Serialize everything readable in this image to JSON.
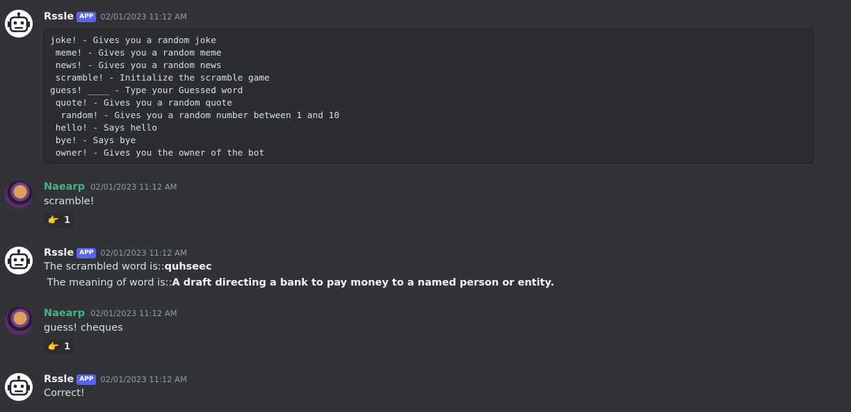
{
  "messages": [
    {
      "author": "Rssle",
      "badge": "APP",
      "timestamp": "02/01/2023 11:12 AM",
      "code_lines": [
        "joke! - Gives you a random joke",
        " meme! - Gives you a random meme",
        " news! - Gives you a random news",
        " scramble! - Initialize the scramble game",
        "guess! ____ - Type your Guessed word",
        " quote! - Gives you a random quote",
        "  random! - Gives you a random number between 1 and 10",
        " hello! - Says hello",
        " bye! - Says bye",
        " owner! - Gives you the owner of the bot"
      ]
    },
    {
      "author": "Naearp",
      "timestamp": "02/01/2023 11:12 AM",
      "text": "scramble!",
      "reaction": {
        "emoji": "👉",
        "count": "1"
      }
    },
    {
      "author": "Rssle",
      "badge": "APP",
      "timestamp": "02/01/2023 11:12 AM",
      "line1_prefix": "The scrambled word is::",
      "line1_bold": "quhseec",
      "line2_prefix": " The meaning of word is::",
      "line2_bold": "A draft directing a bank to pay money to a named person or entity."
    },
    {
      "author": "Naearp",
      "timestamp": "02/01/2023 11:12 AM",
      "text": "guess! cheques",
      "reaction": {
        "emoji": "👉",
        "count": "1"
      }
    },
    {
      "author": "Rssle",
      "badge": "APP",
      "timestamp": "02/01/2023 11:12 AM",
      "text": "Correct!"
    }
  ],
  "icons": {
    "bot_avatar": "robot-icon",
    "user_avatar": "user-avatar"
  },
  "colors": {
    "background": "#313338",
    "badge": "#5865f2",
    "user_name": "#43b581",
    "code_bg": "#2b2d31"
  }
}
